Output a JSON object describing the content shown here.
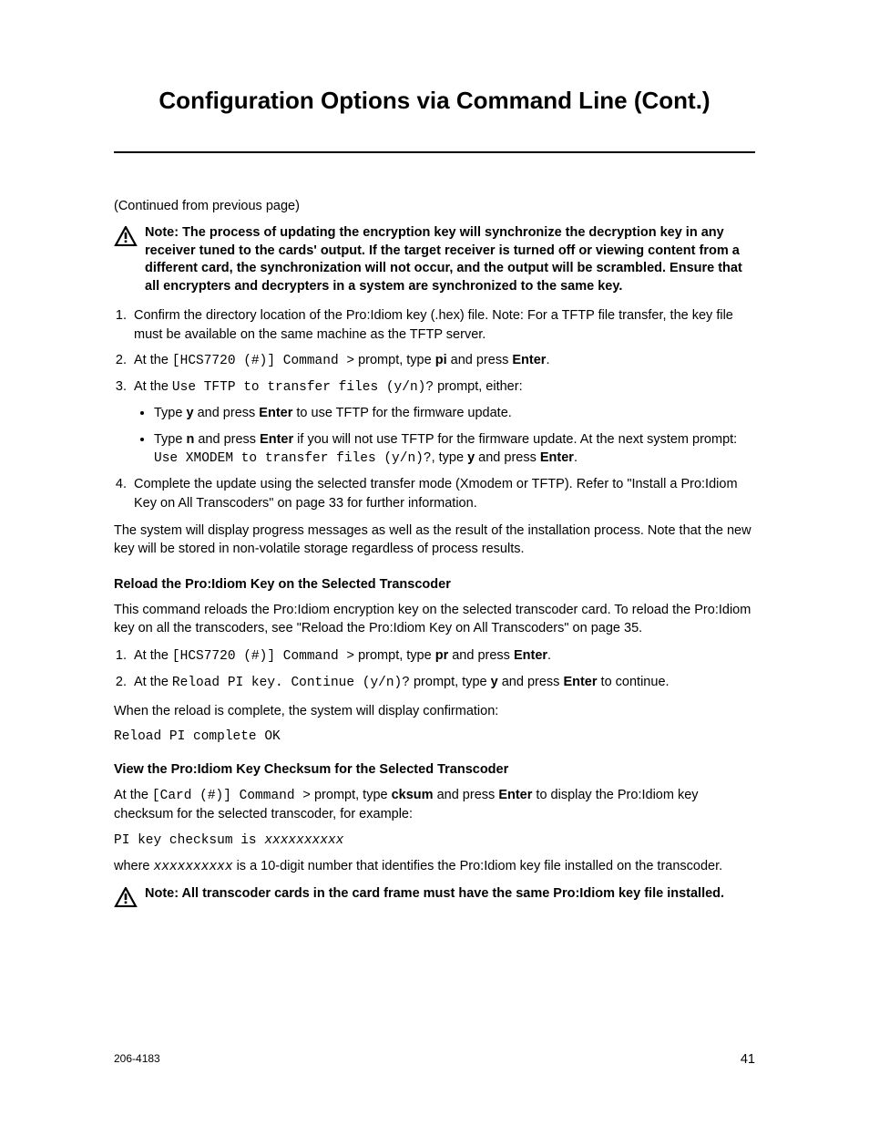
{
  "title": "Configuration Options via Command Line (Cont.)",
  "continued": "(Continued from previous page)",
  "note1": "Note: The process of updating the encryption key will synchronize the decryption key in any receiver tuned to the cards' output. If the target receiver is turned off or viewing content from a different card, the synchronization will not occur, and the output will be scrambled. Ensure that all encrypters and decrypters in a system are synchronized to the same key.",
  "step1": "Confirm the directory location of the Pro:Idiom key (.hex) file. Note: For a TFTP file transfer, the key file must be available on the same machine as the TFTP server.",
  "step2_a": "At the ",
  "step2_mono": "[HCS7720 (#)] Command >",
  "step2_b": " prompt, type ",
  "step2_bold1": "pi",
  "step2_c": " and press ",
  "step2_bold2": "Enter",
  "step2_d": ".",
  "step3_a": "At the ",
  "step3_mono": "Use TFTP to transfer files (y/n)?",
  "step3_b": " prompt, either:",
  "step3_sub1_a": "Type ",
  "step3_sub1_bold1": "y",
  "step3_sub1_b": " and press ",
  "step3_sub1_bold2": "Enter",
  "step3_sub1_c": " to use TFTP for the firmware update.",
  "step3_sub2_a": "Type ",
  "step3_sub2_bold1": "n",
  "step3_sub2_b": " and press ",
  "step3_sub2_bold2": "Enter",
  "step3_sub2_c": " if you will not use TFTP for the firmware update. At the next system prompt: ",
  "step3_sub2_mono": "Use XMODEM to transfer files (y/n)?",
  "step3_sub2_d": ", type ",
  "step3_sub2_bold3": "y",
  "step3_sub2_e": " and press ",
  "step3_sub2_bold4": "Enter",
  "step3_sub2_f": ".",
  "step4": "Complete the update using the selected transfer mode (Xmodem or TFTP). Refer to \"Install a Pro:Idiom Key on All Transcoders\" on page 33 for further information.",
  "para1": "The system will display progress messages as well as the result of the installation process. Note that the new key will be stored in non-volatile storage regardless of process results.",
  "subhead1": "Reload the Pro:Idiom Key on the Selected Transcoder",
  "para2": "This command reloads the Pro:Idiom encryption key on the selected transcoder card. To reload the Pro:Idiom key on all the transcoders, see \"Reload the Pro:Idiom Key on All Transcoders\" on page 35.",
  "r_step1_a": "At the ",
  "r_step1_mono": "[HCS7720 (#)] Command >",
  "r_step1_b": " prompt, type ",
  "r_step1_bold1": "pr",
  "r_step1_c": " and press ",
  "r_step1_bold2": "Enter",
  "r_step1_d": ".",
  "r_step2_a": "At the ",
  "r_step2_mono": "Reload PI key. Continue (y/n)?",
  "r_step2_b": " prompt, type ",
  "r_step2_bold1": "y",
  "r_step2_c": " and press ",
  "r_step2_bold2": "Enter",
  "r_step2_d": " to continue.",
  "para3": "When the reload is complete, the system will display confirmation:",
  "code1": "Reload PI complete OK",
  "subhead2": "View the Pro:Idiom Key Checksum for the Selected Transcoder",
  "para4_a": "At the ",
  "para4_mono": "[Card (#)] Command >",
  "para4_b": " prompt, type ",
  "para4_bold1": "cksum",
  "para4_c": " and press ",
  "para4_bold2": "Enter",
  "para4_d": " to display the Pro:Idiom key checksum for the selected transcoder, for example:",
  "code2_a": "PI key checksum is ",
  "code2_b": "xxxxxxxxxx",
  "para5_a": "where ",
  "para5_mono": "xxxxxxxxxx",
  "para5_b": " is a 10-digit number that identifies the Pro:Idiom key file installed on the transcoder.",
  "note2": "Note: All transcoder cards in the card frame must have the same Pro:Idiom key file installed.",
  "footer_left": "206-4183",
  "footer_right": "41"
}
